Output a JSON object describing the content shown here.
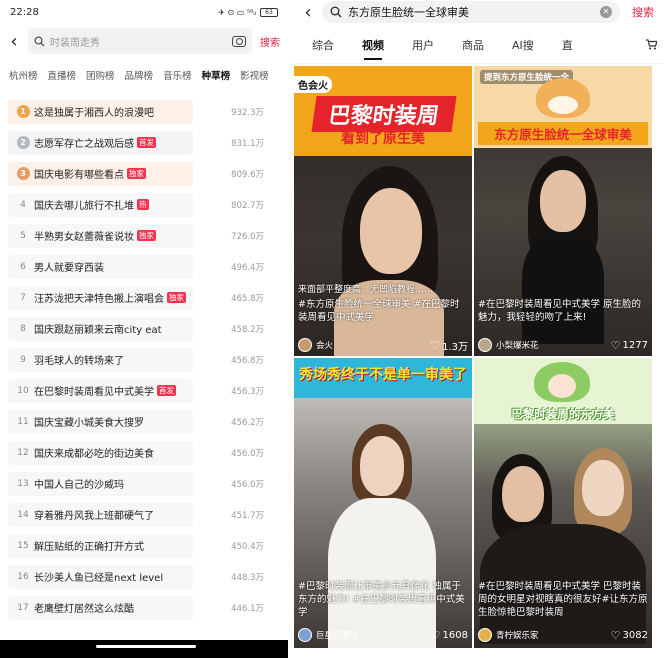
{
  "left_phone": {
    "status": {
      "time": "22:28",
      "icons": "✈ ⊙ ▭ ⁵⁶ᵢₗ",
      "battery": "63"
    },
    "search": {
      "placeholder": "时装周走秀",
      "button": "搜索"
    },
    "tabs": [
      "杭州榜",
      "直播榜",
      "团购榜",
      "品牌榜",
      "音乐榜",
      "种草榜",
      "影视榜"
    ],
    "active_tab": "种草榜",
    "rankings": [
      {
        "rank": "1",
        "title": "这是独属于湘西人的浪漫吧",
        "tag": "",
        "heat": "932.3万"
      },
      {
        "rank": "2",
        "title": "志愿军存亡之战观后感",
        "tag": "首发",
        "heat": "831.1万"
      },
      {
        "rank": "3",
        "title": "国庆电影有哪些看点",
        "tag": "独家",
        "heat": "809.6万"
      },
      {
        "rank": "4",
        "title": "国庆去哪儿旅行不扎堆",
        "tag": "热",
        "heat": "802.7万"
      },
      {
        "rank": "5",
        "title": "半熟男女赵蕾薇雀说妆",
        "tag": "独家",
        "heat": "726.0万"
      },
      {
        "rank": "6",
        "title": "男人就要穿西装",
        "tag": "",
        "heat": "496.4万"
      },
      {
        "rank": "7",
        "title": "汪苏泷把天津特色搬上演唱会",
        "tag": "独家",
        "heat": "465.8万"
      },
      {
        "rank": "8",
        "title": "国庆跟赵丽颖来云南city eat",
        "tag": "",
        "heat": "458.2万"
      },
      {
        "rank": "9",
        "title": "羽毛球人的转场来了",
        "tag": "",
        "heat": "456.8万"
      },
      {
        "rank": "10",
        "title": "在巴黎时装周看见中式美学",
        "tag": "首发",
        "heat": "456.3万"
      },
      {
        "rank": "11",
        "title": "国庆宝藏小城美食大搜罗",
        "tag": "",
        "heat": "456.2万"
      },
      {
        "rank": "12",
        "title": "国庆来成都必吃的街边美食",
        "tag": "",
        "heat": "456.0万"
      },
      {
        "rank": "13",
        "title": "中国人自己的沙威玛",
        "tag": "",
        "heat": "456.0万"
      },
      {
        "rank": "14",
        "title": "穿着雅丹风我上班都硬气了",
        "tag": "",
        "heat": "451.7万"
      },
      {
        "rank": "15",
        "title": "解压贴纸的正确打开方式",
        "tag": "",
        "heat": "450.4万"
      },
      {
        "rank": "16",
        "title": "长沙美人鱼已经是next level",
        "tag": "",
        "heat": "448.3万"
      },
      {
        "rank": "17",
        "title": "老鹰壁灯居然这么炫酷",
        "tag": "",
        "heat": "446.1万"
      }
    ]
  },
  "right_phone": {
    "search": {
      "query": "东方原生脸统一全球审美",
      "button": "搜索"
    },
    "tabs": [
      "综合",
      "视频",
      "用户",
      "商品",
      "AI搜",
      "直"
    ],
    "active_tab": "视频",
    "cards": [
      {
        "banner_top": "色会火",
        "banner_main": "巴黎时装周",
        "banner_sub": "看到了原生美",
        "caption": "#东方原生脸统一全球审美 #在巴黎时装周看见中式美学",
        "overlay": "来面部平整度高、无凹陷教程……",
        "author": "会火",
        "likes": "1.3万"
      },
      {
        "banner_top": "提到东方原生脸统一全",
        "banner_main": "东方原生脸统一全球审美",
        "caption": "#在巴黎时装周看见中式美学 原生脸的魅力，我轻轻的吻了上来!",
        "author": "小梨爆米花",
        "likes": "1277"
      },
      {
        "banner_main": "秀场秀终于不是单一审美了",
        "caption": "#巴黎时装周让审美多元具像化 独属于东方的魅力! #在巴黎时装周看见中式美学",
        "author": "巨星花栗鼠",
        "likes": "1608"
      },
      {
        "banner_main": "巴黎时装周的东方美",
        "caption": "#在巴黎时装周看见中式美学 巴黎时装周的女明星对视瞎真的很友好#让东方原生脸惊艳巴黎时装周",
        "author": "青柠娱乐家",
        "likes": "3082"
      }
    ]
  },
  "colors": {
    "accent_red": "#e6203e",
    "tag_red": "#f0344f",
    "medal_gold": "#f2a24a",
    "medal_silver": "#b4b8c2",
    "medal_bronze": "#e39b6a",
    "banner_orange": "#f2a71d",
    "banner_red": "#e8242a",
    "banner_green": "#6cc04a"
  }
}
